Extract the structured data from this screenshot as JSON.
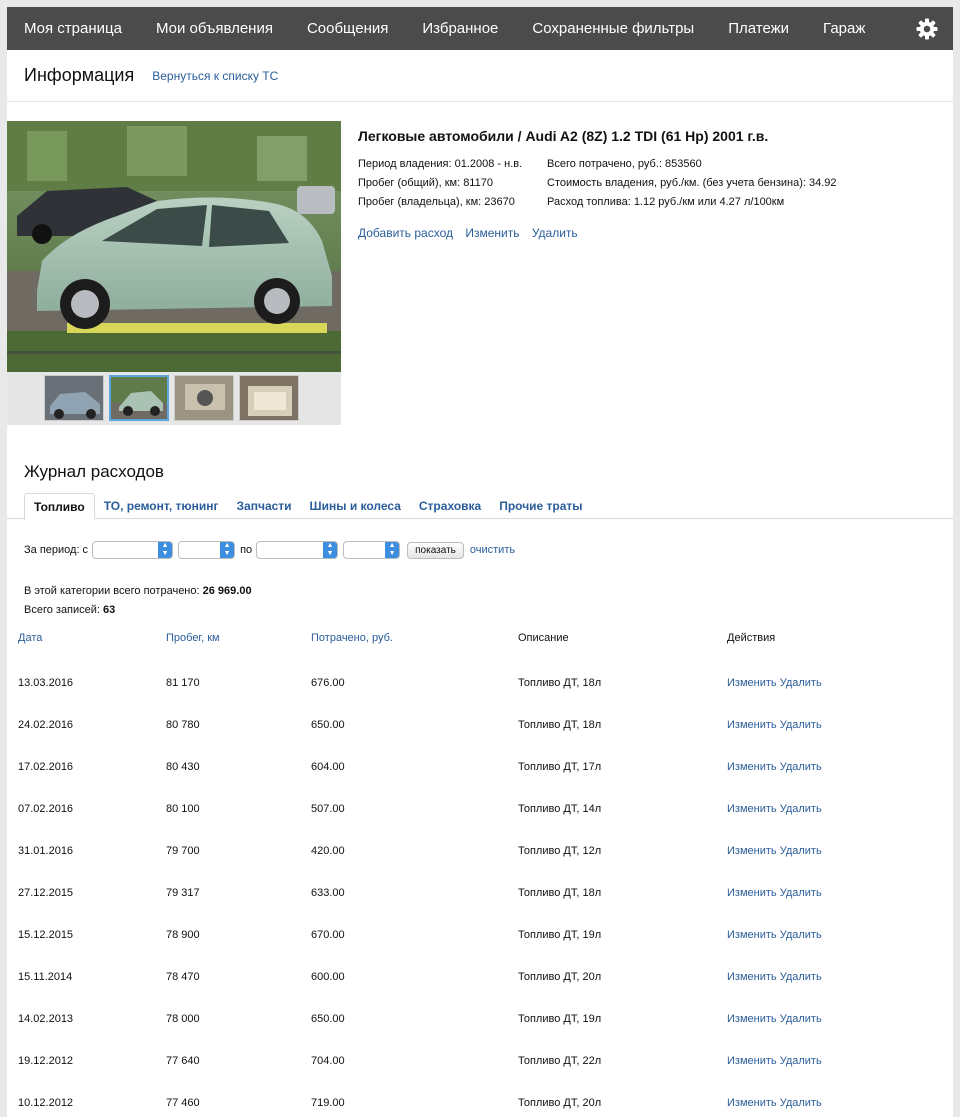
{
  "nav": {
    "items": [
      "Моя страница",
      "Мои объявления",
      "Сообщения",
      "Избранное",
      "Сохраненные фильтры",
      "Платежи",
      "Гараж"
    ]
  },
  "header": {
    "title": "Информация",
    "back_link": "Вернуться к списку ТС"
  },
  "car": {
    "title": "Легковые автомобили / Audi A2 (8Z) 1.2 TDI (61 Hp) 2001 г.в.",
    "stats_left": [
      "Период владения: 01.2008 - н.в.",
      "Пробег (общий), км: 81170",
      "Пробег (владельца), км: 23670"
    ],
    "stats_right": [
      "Всего потрачено, руб.: 853560",
      "Стоимость владения, руб./км. (без учета бензина): 34.92",
      "Расход топлива: 1.12 руб./км или 4.27 л/100км"
    ],
    "actions": [
      "Добавить расход",
      "Изменить",
      "Удалить"
    ]
  },
  "journal": {
    "title": "Журнал расходов",
    "tabs": [
      "Топливо",
      "ТО, ремонт, тюнинг",
      "Запчасти",
      "Шины и колеса",
      "Страховка",
      "Прочие траты"
    ],
    "filter": {
      "label": "За период: с",
      "to_label": "по",
      "show_button": "показать",
      "clear_link": "очистить"
    },
    "summary": {
      "spent_label": "В этой категории всего потрачено:",
      "spent_value": "26 969.00",
      "records_label": "Всего записей:",
      "records_value": "63"
    },
    "columns": [
      "Дата",
      "Пробег, км",
      "Потрачено, руб.",
      "Описание",
      "Действия"
    ],
    "row_actions": [
      "Изменить",
      "Удалить"
    ],
    "rows": [
      {
        "date": "13.03.2016",
        "mileage": "81 170",
        "spent": "676.00",
        "desc": "Топливо ДТ, 18л"
      },
      {
        "date": "24.02.2016",
        "mileage": "80 780",
        "spent": "650.00",
        "desc": "Топливо ДТ, 18л"
      },
      {
        "date": "17.02.2016",
        "mileage": "80 430",
        "spent": "604.00",
        "desc": "Топливо ДТ, 17л"
      },
      {
        "date": "07.02.2016",
        "mileage": "80 100",
        "spent": "507.00",
        "desc": "Топливо ДТ, 14л"
      },
      {
        "date": "31.01.2016",
        "mileage": "79 700",
        "spent": "420.00",
        "desc": "Топливо ДТ, 12л"
      },
      {
        "date": "27.12.2015",
        "mileage": "79 317",
        "spent": "633.00",
        "desc": "Топливо ДТ, 18л"
      },
      {
        "date": "15.12.2015",
        "mileage": "78 900",
        "spent": "670.00",
        "desc": "Топливо ДТ, 19л"
      },
      {
        "date": "15.11.2014",
        "mileage": "78 470",
        "spent": "600.00",
        "desc": "Топливо ДТ, 20л"
      },
      {
        "date": "14.02.2013",
        "mileage": "78 000",
        "spent": "650.00",
        "desc": "Топливо ДТ, 19л"
      },
      {
        "date": "19.12.2012",
        "mileage": "77 640",
        "spent": "704.00",
        "desc": "Топливо ДТ, 22л"
      },
      {
        "date": "10.12.2012",
        "mileage": "77 460",
        "spent": "719.00",
        "desc": "Топливо ДТ, 20л"
      }
    ]
  }
}
